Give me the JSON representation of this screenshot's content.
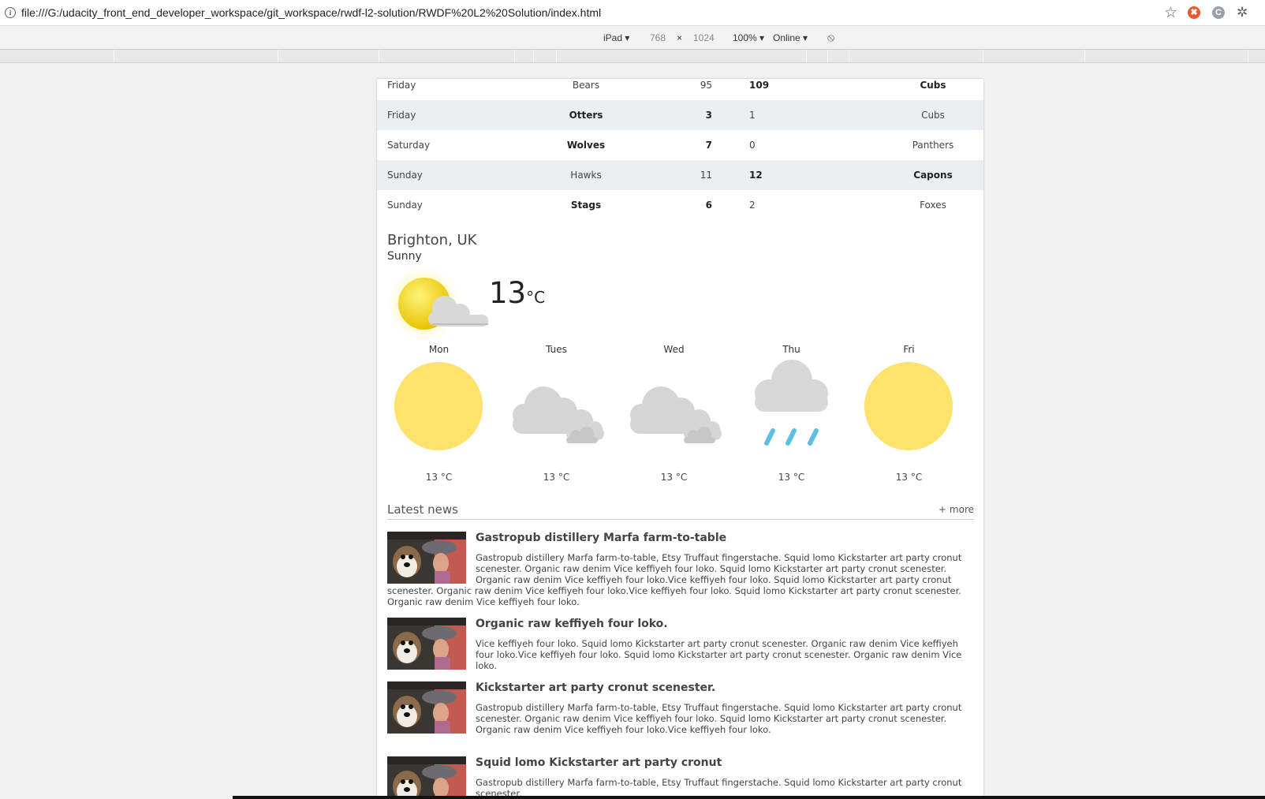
{
  "browser": {
    "url": "file:///G:/udacity_front_end_developer_workspace/git_workspace/rwdf-l2-solution/RWDF%20L2%20Solution/index.html",
    "ext1": "✖",
    "ext2": "C"
  },
  "devtools": {
    "device": "iPad ▾",
    "width": "768",
    "times": "×",
    "height": "1024",
    "zoom": "100% ▾",
    "network": "Online ▾"
  },
  "scores": [
    {
      "day": "Friday",
      "home": "Bears",
      "home_score": "95",
      "away_score": "109",
      "away": "Cubs",
      "winner": "away"
    },
    {
      "day": "Friday",
      "home": "Otters",
      "home_score": "3",
      "away_score": "1",
      "away": "Cubs",
      "winner": "home"
    },
    {
      "day": "Saturday",
      "home": "Wolves",
      "home_score": "7",
      "away_score": "0",
      "away": "Panthers",
      "winner": "home"
    },
    {
      "day": "Sunday",
      "home": "Hawks",
      "home_score": "11",
      "away_score": "12",
      "away": "Capons",
      "winner": "away"
    },
    {
      "day": "Sunday",
      "home": "Stags",
      "home_score": "6",
      "away_score": "2",
      "away": "Foxes",
      "winner": "home"
    }
  ],
  "weather": {
    "city": "Brighton, UK",
    "condition": "Sunny",
    "temp": "13",
    "unit": "°C",
    "icon": "partly-sunny-icon",
    "forecast": [
      {
        "day": "Mon",
        "icon": "sun-icon",
        "temp": "13 °C"
      },
      {
        "day": "Tues",
        "icon": "cloudy-icon",
        "temp": "13 °C"
      },
      {
        "day": "Wed",
        "icon": "cloudy-icon",
        "temp": "13 °C"
      },
      {
        "day": "Thu",
        "icon": "rain-icon",
        "temp": "13 °C"
      },
      {
        "day": "Fri",
        "icon": "sun-icon",
        "temp": "13 °C"
      }
    ]
  },
  "news": {
    "title": "Latest news",
    "more": "+ more",
    "articles": [
      {
        "title": "Gastropub distillery Marfa farm-to-table",
        "body": "Gastropub distillery Marfa farm-to-table, Etsy Truffaut fingerstache. Squid lomo Kickstarter art party cronut scenester. Organic raw denim Vice keffiyeh four loko. Squid lomo Kickstarter art party cronut scenester. Organic raw denim Vice keffiyeh four loko.Vice keffiyeh four loko. Squid lomo Kickstarter art party cronut scenester. Organic raw denim Vice keffiyeh four loko.Vice keffiyeh four loko. Squid lomo Kickstarter art party cronut scenester. Organic raw denim Vice keffiyeh four loko."
      },
      {
        "title": "Organic raw keffiyeh four loko.",
        "body": "Vice keffiyeh four loko. Squid lomo Kickstarter art party cronut scenester. Organic raw denim Vice keffiyeh four loko.Vice keffiyeh four loko. Squid lomo Kickstarter art party cronut scenester. Organic raw denim Vice loko."
      },
      {
        "title": "Kickstarter art party cronut scenester.",
        "body": "Gastropub distillery Marfa farm-to-table, Etsy Truffaut fingerstache. Squid lomo Kickstarter art party cronut scenester. Organic raw denim Vice keffiyeh four loko. Squid lomo Kickstarter art party cronut scenester. Organic raw denim Vice keffiyeh four loko.Vice keffiyeh four loko."
      },
      {
        "title": "Squid lomo Kickstarter art party cronut",
        "body": "Gastropub distillery Marfa farm-to-table, Etsy Truffaut fingerstache. Squid lomo Kickstarter art party cronut scenester."
      }
    ]
  }
}
